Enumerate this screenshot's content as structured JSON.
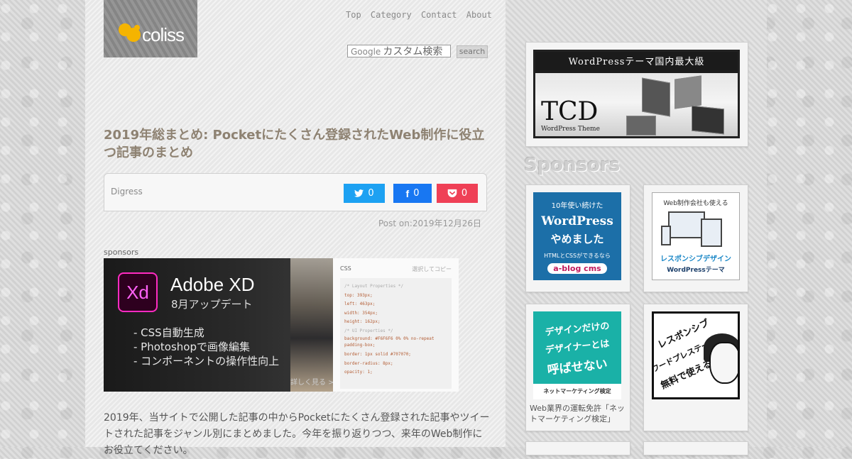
{
  "header": {
    "logo_text": "coliss",
    "nav": [
      "Top",
      "Category",
      "Contact",
      "About"
    ],
    "search": {
      "placeholder": "カスタム検索",
      "brand": "Google",
      "button": "search"
    }
  },
  "post": {
    "title": "2019年総まとめ: Pocketにたくさん登録されたWeb制作に役立つ記事のまとめ",
    "category": "Digress",
    "share": {
      "twitter_count": "0",
      "facebook_count": "0",
      "pocket_count": "0"
    },
    "post_date": "Post on:2019年12月26日",
    "body": "2019年、当サイトで公開した記事の中からPocketにたくさん登録された記事やツイートされた記事をジャンル別にまとめました。今年を振り返りつつ、来年のWeb制作にお役立てください。"
  },
  "ad": {
    "label": "sponsors",
    "logo": "Xd",
    "title": "Adobe XD",
    "subtitle": "8月アップデート",
    "features": [
      "- CSS自動生成",
      "- Photoshopで画像編集",
      "- コンポーネントの操作性向上"
    ],
    "more": "詳しく見る >",
    "panel_title": "CSS",
    "panel_copy": "選択してコピー",
    "code": [
      "/* Layout Properties */",
      "top: 393px;",
      "left: 463px;",
      "width: 354px;",
      "height: 162px;",
      "/* UI Properties */",
      "background: #F6F6F6 0% 0% no-repeat padding-box;",
      "border: 1px solid #707070;",
      "border-radius: 8px;",
      "opacity: 1;"
    ]
  },
  "sidebar": {
    "tcd": {
      "band": "WordPressテーマ国内最大級",
      "big": "TCD",
      "small": "WordPress Theme"
    },
    "sponsors_heading": "Sponsors",
    "banner1": {
      "l1": "10年使い続けた",
      "l2": "WordPress",
      "l3": "やめました",
      "l4": "HTMLとCSSができるなら",
      "l5": "a-blog cms"
    },
    "banner2": {
      "l1": "Web制作会社も使える",
      "l2": "レスポンシブデザイン",
      "l3": "WordPressテーマ"
    },
    "banner3": {
      "l1": "デザインだけの",
      "l2": "デザイナーとは",
      "l3": "呼ばせない",
      "foot": "ネットマーケティング検定"
    },
    "banner3_caption": "Web業界の運転免許「ネットマーケティング検定」",
    "banner4": {
      "l1": "レスポンシブ",
      "l2": "ワードプレステーマが",
      "l3": "無料で使える!"
    }
  },
  "colors": {
    "twitter": "#1da1f2",
    "facebook": "#1877f2",
    "pocket": "#ef4056",
    "title": "#8e8272"
  }
}
